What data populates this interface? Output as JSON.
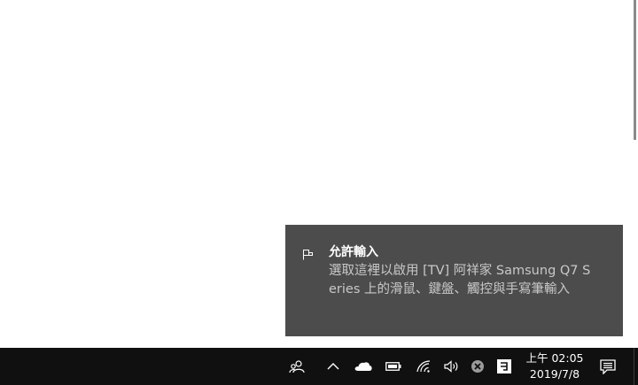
{
  "toast": {
    "icon": "input-keyboard-icon",
    "title": "允許輸入",
    "body": "選取這裡以啟用 [TV] 阿祥家 Samsung Q7 Series 上的滑鼠、鍵盤、觸控與手寫筆輸入"
  },
  "taskbar": {
    "tray_icons": [
      "people-icon",
      "chevron-up-icon",
      "onedrive-icon",
      "battery-icon",
      "wifi-icon",
      "volume-icon",
      "close-circle-icon",
      "input-method-icon"
    ],
    "clock": {
      "time": "上午 02:05",
      "date": "2019/7/8"
    },
    "action_center_icon": "action-center-icon"
  },
  "colors": {
    "toast_bg": "#4c4c4c",
    "taskbar_bg": "#101010",
    "text_primary": "#ffffff",
    "text_secondary": "#c8c8c8"
  }
}
